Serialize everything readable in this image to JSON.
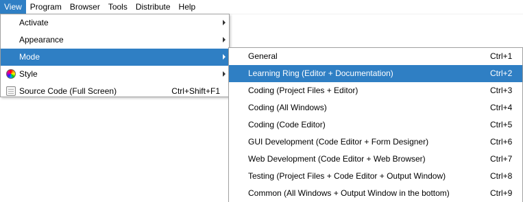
{
  "menubar": {
    "items": [
      "View",
      "Program",
      "Browser",
      "Tools",
      "Distribute",
      "Help"
    ],
    "active_index": 0
  },
  "view_menu": {
    "items": [
      {
        "label": "Activate",
        "shortcut": "",
        "submenu": true,
        "icon": ""
      },
      {
        "label": "Appearance",
        "shortcut": "",
        "submenu": true,
        "icon": ""
      },
      {
        "label": "Mode",
        "shortcut": "",
        "submenu": true,
        "icon": "",
        "active": true
      },
      {
        "label": "Style",
        "shortcut": "",
        "submenu": true,
        "icon": "color-wheel-icon"
      },
      {
        "label": "Source Code (Full Screen)",
        "shortcut": "Ctrl+Shift+F1",
        "submenu": false,
        "icon": "source-code-icon"
      }
    ]
  },
  "mode_menu": {
    "items": [
      {
        "label": "General",
        "shortcut": "Ctrl+1"
      },
      {
        "label": "Learning Ring (Editor + Documentation)",
        "shortcut": "Ctrl+2",
        "active": true
      },
      {
        "label": "Coding (Project Files + Editor)",
        "shortcut": "Ctrl+3"
      },
      {
        "label": "Coding (All Windows)",
        "shortcut": "Ctrl+4"
      },
      {
        "label": "Coding (Code Editor)",
        "shortcut": "Ctrl+5"
      },
      {
        "label": "GUI Development (Code Editor + Form Designer)",
        "shortcut": "Ctrl+6"
      },
      {
        "label": "Web Development (Code Editor + Web Browser)",
        "shortcut": "Ctrl+7"
      },
      {
        "label": "Testing (Project Files + Code Editor + Output Window)",
        "shortcut": "Ctrl+8"
      },
      {
        "label": "Common (All Windows + Output Window in the bottom)",
        "shortcut": "Ctrl+9"
      }
    ]
  },
  "colors": {
    "highlight": "#2f7fc4",
    "highlight_text": "#ffffff",
    "menu_border": "#a0a0a0"
  }
}
